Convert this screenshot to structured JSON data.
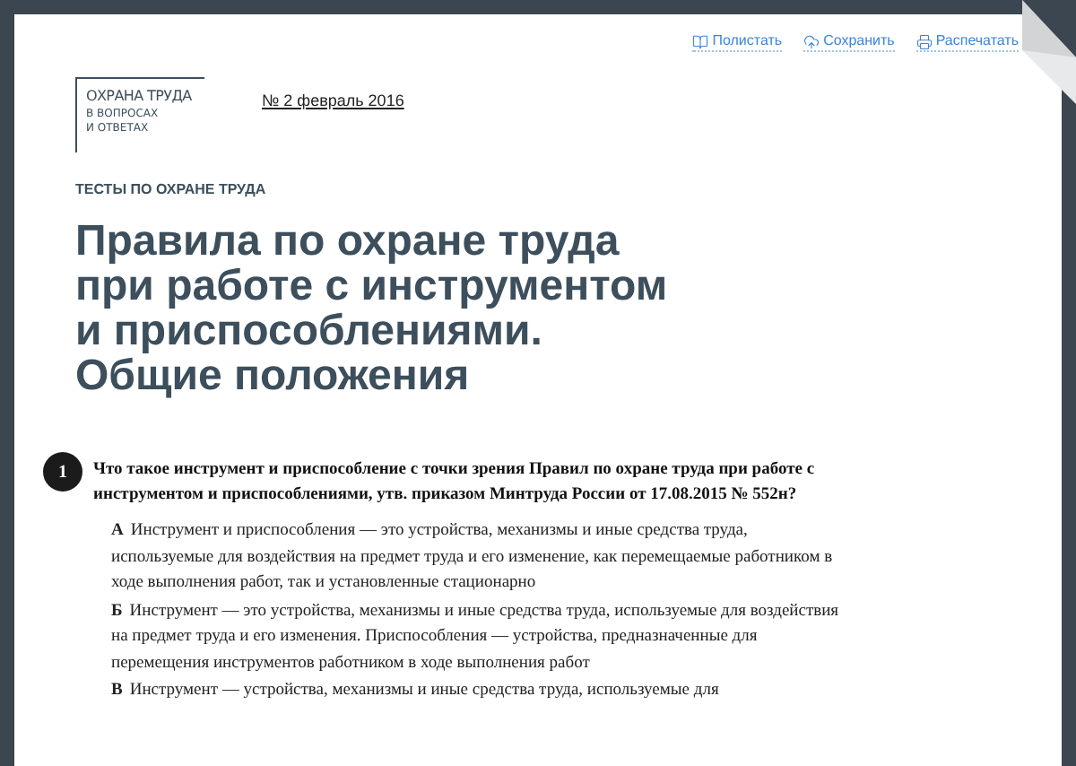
{
  "toolbar": [
    {
      "kind": "book",
      "label": "Полистать"
    },
    {
      "kind": "cloud",
      "label": "Сохранить"
    },
    {
      "kind": "print",
      "label": "Распечатать"
    }
  ],
  "logo": {
    "title": "ОХРАНА ТРУДА",
    "subtitle_lines": [
      "В ВОПРОСАХ",
      "И ОТВЕТАХ"
    ]
  },
  "issue": "№ 2 февраль 2016",
  "section": "ТЕСТЫ ПО ОХРАНЕ ТРУДА",
  "title_lines": [
    "Правила по охране труда",
    "при работе с инструментом",
    "и приспособлениями.",
    "Общие положения"
  ],
  "question": {
    "number": "1",
    "text": "Что такое инструмент и приспособление с точки зрения Правил по охране труда при работе с инструментом и приспособлениями, утв. приказом Минтруда России от 17.08.2015 № 552н?",
    "answers": [
      {
        "letter": "А",
        "text": "Инструмент и приспособления — это устройства, механизмы и иные средства труда, используемые для воздействия на предмет труда и его изменение, как перемещаемые работником в ходе выполнения работ, так и установленные стационарно"
      },
      {
        "letter": "Б",
        "text": "Инструмент — это устройства, механизмы и иные средства труда, используемые для воздействия на предмет труда и его изменения. Приспособления — устройства, предназначенные для перемещения инструментов работником в ходе выполнения работ"
      },
      {
        "letter": "В",
        "text": "Инструмент — устройства, механизмы и иные средства труда, используемые для"
      }
    ]
  }
}
